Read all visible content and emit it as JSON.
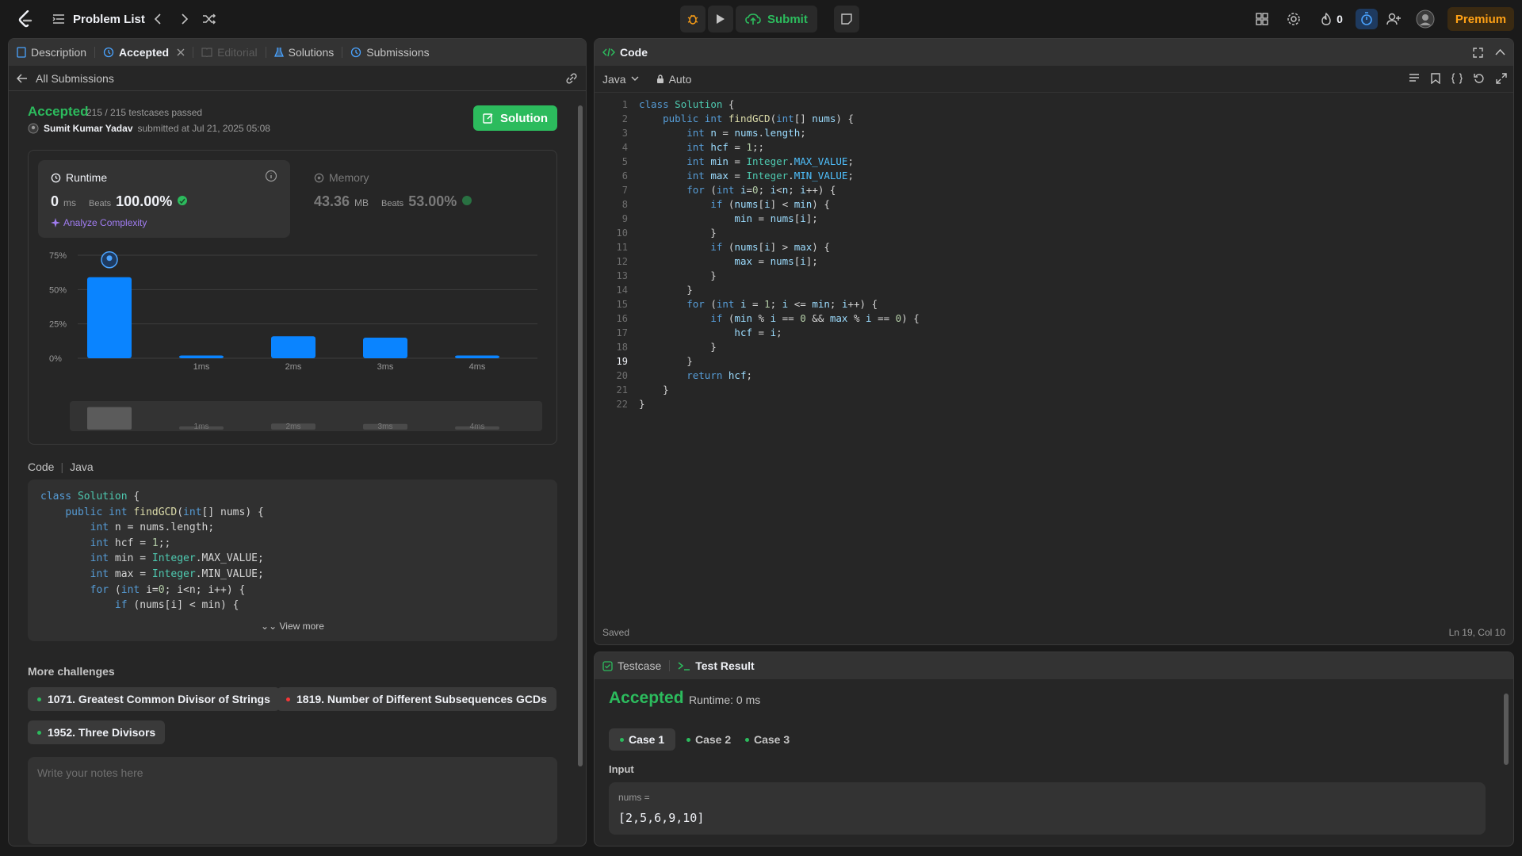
{
  "topbar": {
    "problem_list": "Problem List",
    "submit_label": "Submit",
    "streak_count": "0",
    "premium_label": "Premium"
  },
  "left_tabs": [
    {
      "label": "Description"
    },
    {
      "label": "Accepted"
    },
    {
      "label": "Editorial"
    },
    {
      "label": "Solutions"
    },
    {
      "label": "Submissions"
    }
  ],
  "submission": {
    "back_label": "All Submissions",
    "status": "Accepted",
    "testcases": "215 / 215 testcases passed",
    "author": "Sumit Kumar Yadav",
    "submitted_text": "submitted at Jul 21, 2025 05:08",
    "solution_button": "Solution"
  },
  "runtime": {
    "title": "Runtime",
    "value": "0",
    "unit": "ms",
    "beats_label": "Beats",
    "beats_pct": "100.00%",
    "analyze_label": "Analyze Complexity"
  },
  "memory": {
    "title": "Memory",
    "value": "43.36",
    "unit": "MB",
    "beats_label": "Beats",
    "beats_pct": "53.00%"
  },
  "chart_data": {
    "type": "bar",
    "categories": [
      "0ms",
      "1ms",
      "2ms",
      "3ms",
      "4ms"
    ],
    "tick_labels": [
      "",
      "1ms",
      "2ms",
      "3ms",
      "4ms"
    ],
    "values": [
      59,
      2,
      16,
      15,
      2
    ],
    "yticks": [
      "75%",
      "50%",
      "25%",
      "0%"
    ],
    "ytick_values": [
      75,
      50,
      25,
      0
    ],
    "ylim": [
      0,
      75
    ],
    "grid": true,
    "bar_color": "#0a84ff",
    "overview_labels": [
      "1ms",
      "2ms",
      "3ms",
      "4ms"
    ]
  },
  "code_section": {
    "label": "Code",
    "lang": "Java",
    "view_more": "View more"
  },
  "more_challenges": {
    "title": "More challenges",
    "items": [
      {
        "label": "1071. Greatest Common Divisor of Strings",
        "color": "#2cbb5d"
      },
      {
        "label": "1819. Number of Different Subsequences GCDs",
        "color": "#f63737"
      },
      {
        "label": "1952. Three Divisors",
        "color": "#2cbb5d"
      }
    ]
  },
  "notes": {
    "placeholder": "Write your notes here"
  },
  "code_panel": {
    "title": "Code",
    "language": "Java",
    "mode": "Auto",
    "saved_label": "Saved",
    "cursor": "Ln 19, Col 10"
  },
  "result_panel": {
    "tabs": [
      {
        "label": "Testcase"
      },
      {
        "label": "Test Result"
      }
    ],
    "status": "Accepted",
    "runtime": "Runtime: 0 ms",
    "cases": [
      {
        "label": "Case 1"
      },
      {
        "label": "Case 2"
      },
      {
        "label": "Case 3"
      }
    ],
    "input_label": "Input",
    "input_name": "nums =",
    "input_value": "[2,5,6,9,10]"
  },
  "colors": {
    "accepted_green": "#2cbb5d",
    "premium_orange": "#ffa116",
    "bar_blue": "#0a84ff",
    "analyze_purple": "#a07cf0"
  }
}
